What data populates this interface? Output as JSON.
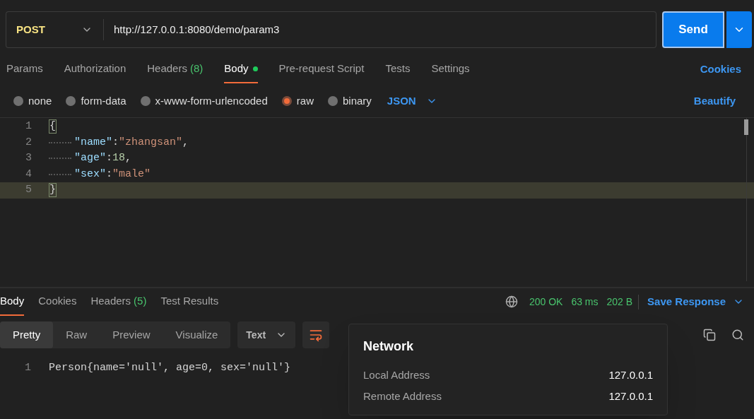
{
  "request": {
    "method": "POST",
    "url": "http://127.0.0.1:8080/demo/param3",
    "send": "Send"
  },
  "tabs": [
    {
      "label": "Params",
      "selected": false
    },
    {
      "label": "Authorization",
      "selected": false
    },
    {
      "label": "Headers",
      "count": "(8)",
      "selected": false
    },
    {
      "label": "Body",
      "selected": true,
      "dot": true
    },
    {
      "label": "Pre-request Script",
      "selected": false
    },
    {
      "label": "Tests",
      "selected": false
    },
    {
      "label": "Settings",
      "selected": false
    }
  ],
  "cookies_link": "Cookies",
  "body_types": [
    {
      "label": "none",
      "selected": false
    },
    {
      "label": "form-data",
      "selected": false
    },
    {
      "label": "x-www-form-urlencoded",
      "selected": false
    },
    {
      "label": "raw",
      "selected": true
    },
    {
      "label": "binary",
      "selected": false
    }
  ],
  "format": "JSON",
  "beautify": "Beautify",
  "editor": {
    "lines": [
      {
        "number": "1",
        "current": false,
        "indent": false,
        "tokens": [
          {
            "kind": "brace",
            "text": "{"
          }
        ]
      },
      {
        "number": "2",
        "current": false,
        "indent": true,
        "tokens": [
          {
            "kind": "key",
            "text": "\"name\""
          },
          {
            "kind": "punct",
            "text": ":"
          },
          {
            "kind": "string",
            "text": "\"zhangsan\""
          },
          {
            "kind": "punct",
            "text": ","
          }
        ]
      },
      {
        "number": "3",
        "current": false,
        "indent": true,
        "tokens": [
          {
            "kind": "key",
            "text": "\"age\""
          },
          {
            "kind": "punct",
            "text": ":"
          },
          {
            "kind": "number",
            "text": "18"
          },
          {
            "kind": "punct",
            "text": ","
          }
        ]
      },
      {
        "number": "4",
        "current": false,
        "indent": true,
        "tokens": [
          {
            "kind": "key",
            "text": "\"sex\""
          },
          {
            "kind": "punct",
            "text": ":"
          },
          {
            "kind": "string",
            "text": "\"male\""
          }
        ]
      },
      {
        "number": "5",
        "current": true,
        "indent": false,
        "tokens": [
          {
            "kind": "brace",
            "text": "}"
          }
        ]
      }
    ]
  },
  "response": {
    "tabs": [
      {
        "label": "Body",
        "selected": true
      },
      {
        "label": "Cookies",
        "selected": false
      },
      {
        "label": "Headers",
        "count": "(5)",
        "selected": false
      },
      {
        "label": "Test Results",
        "selected": false
      }
    ],
    "status": "200 OK",
    "time": "63 ms",
    "size": "202 B",
    "save": "Save Response",
    "views": [
      {
        "label": "Pretty",
        "selected": true
      },
      {
        "label": "Raw",
        "selected": false
      },
      {
        "label": "Preview",
        "selected": false
      },
      {
        "label": "Visualize",
        "selected": false
      }
    ],
    "type": "Text",
    "lines": [
      {
        "number": "1",
        "text": "Person{name='null', age=0, sex='null'}"
      }
    ]
  },
  "network": {
    "title": "Network",
    "rows": [
      {
        "label": "Local Address",
        "value": "127.0.0.1"
      },
      {
        "label": "Remote Address",
        "value": "127.0.0.1"
      }
    ]
  }
}
